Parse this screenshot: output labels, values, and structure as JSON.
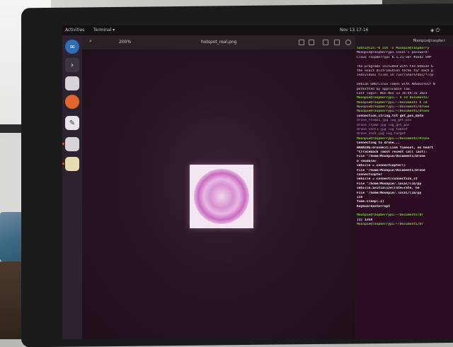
{
  "topbar": {
    "activities": "Activities",
    "app_name": "Terminal ▾",
    "clock": "Nov 13  17:16",
    "system_icons": "◈ ⏻"
  },
  "viewer": {
    "zoom": "200%",
    "filename": "hotspot_real.png"
  },
  "terminal": {
    "title": "Moonpie@raspber",
    "lines": [
      {
        "text": "Subsi@lin:~$ ssh -x Moonpie@raspberry",
        "style": "g"
      },
      {
        "text": "Moonpie@raspberrypi.local's password:",
        "style": ""
      },
      {
        "text": "Linux raspberrypi 6.1.21-v8+ #1642 SMP",
        "style": ""
      },
      {
        "text": "",
        "style": ""
      },
      {
        "text": "The programs included with the Debian G",
        "style": ""
      },
      {
        "text": "the exact distribution terms for each p",
        "style": ""
      },
      {
        "text": "individual files in /usr/share/doc/*/co",
        "style": ""
      },
      {
        "text": "",
        "style": ""
      },
      {
        "text": "Debian GNU/Linux comes with ABSOLUTELY N",
        "style": ""
      },
      {
        "text": "permitted by applicable law.",
        "style": ""
      },
      {
        "text": "Last login: Mon Nov 13 16:49:31 2023",
        "style": ""
      },
      {
        "text": "Moonpie@raspberrypi:~ $ cd Documents/",
        "style": "g"
      },
      {
        "text": "Moonpie@raspberrypi:~/Documents $ cd",
        "style": "g"
      },
      {
        "text": "Moonpie@raspberrypi:~/Documents/Drone",
        "style": "g"
      },
      {
        "text": "Moonpie@raspberrypi:~/Documents/Drone",
        "style": "g"
      },
      {
        "text": "connection_string.txt   get_pos_data",
        "style": "w"
      },
      {
        "text": "drone_frame1.jpg        log_get_pos",
        "style": "p"
      },
      {
        "text": "drone_frame.jpg         log_get_pos",
        "style": "p"
      },
      {
        "text": "drone_shot1.jpg         log_takeof",
        "style": "p"
      },
      {
        "text": "drone_shot.jpg          log_target",
        "style": "p"
      },
      {
        "text": "Moonpie@raspberrypi:~/Documents/Drone",
        "style": "g"
      },
      {
        "text": "Connecting to drone...",
        "style": "w"
      },
      {
        "text": "WARNING:dronekit:Link timeout, no heart",
        "style": "w"
      },
      {
        "text": "^CTraceback (most recent call last):",
        "style": "w"
      },
      {
        "text": "  File \"/home/Moonpie/Documents/Drone",
        "style": "w"
      },
      {
        "text": "n <module>",
        "style": "w"
      },
      {
        "text": "    vehicle = connectcopter()",
        "style": "w"
      },
      {
        "text": "  File \"/home/Moonpie/Documents/Drone",
        "style": "w"
      },
      {
        "text": "connectcopter",
        "style": "w"
      },
      {
        "text": "    vehicle = connect(connection_st",
        "style": "w"
      },
      {
        "text": "  File \"/home/Moonpie/.local/lib/py",
        "style": "w"
      },
      {
        "text": "    vehicle.initialize(rate=rate, he",
        "style": "w"
      },
      {
        "text": "  File \"/home/Moonpie/.local/lib/py",
        "style": "w"
      },
      {
        "text": "ize",
        "style": "w"
      },
      {
        "text": "    time.sleep(.1)",
        "style": "w"
      },
      {
        "text": "KeyboardInterrupt",
        "style": "w"
      },
      {
        "text": "",
        "style": ""
      },
      {
        "text": "Moonpie@raspberrypi:~/Documents/Dr",
        "style": "g"
      },
      {
        "text": "[1] 1358",
        "style": "w"
      },
      {
        "text": "Moonpie@raspberrypi:~/Documents/Dr",
        "style": "g"
      }
    ]
  },
  "colors": {
    "screen_bg": "#24131f",
    "terminal_bg": "#2b0c22",
    "prompt_green": "#7ad13a",
    "thumb_pink": "#d792d0"
  }
}
